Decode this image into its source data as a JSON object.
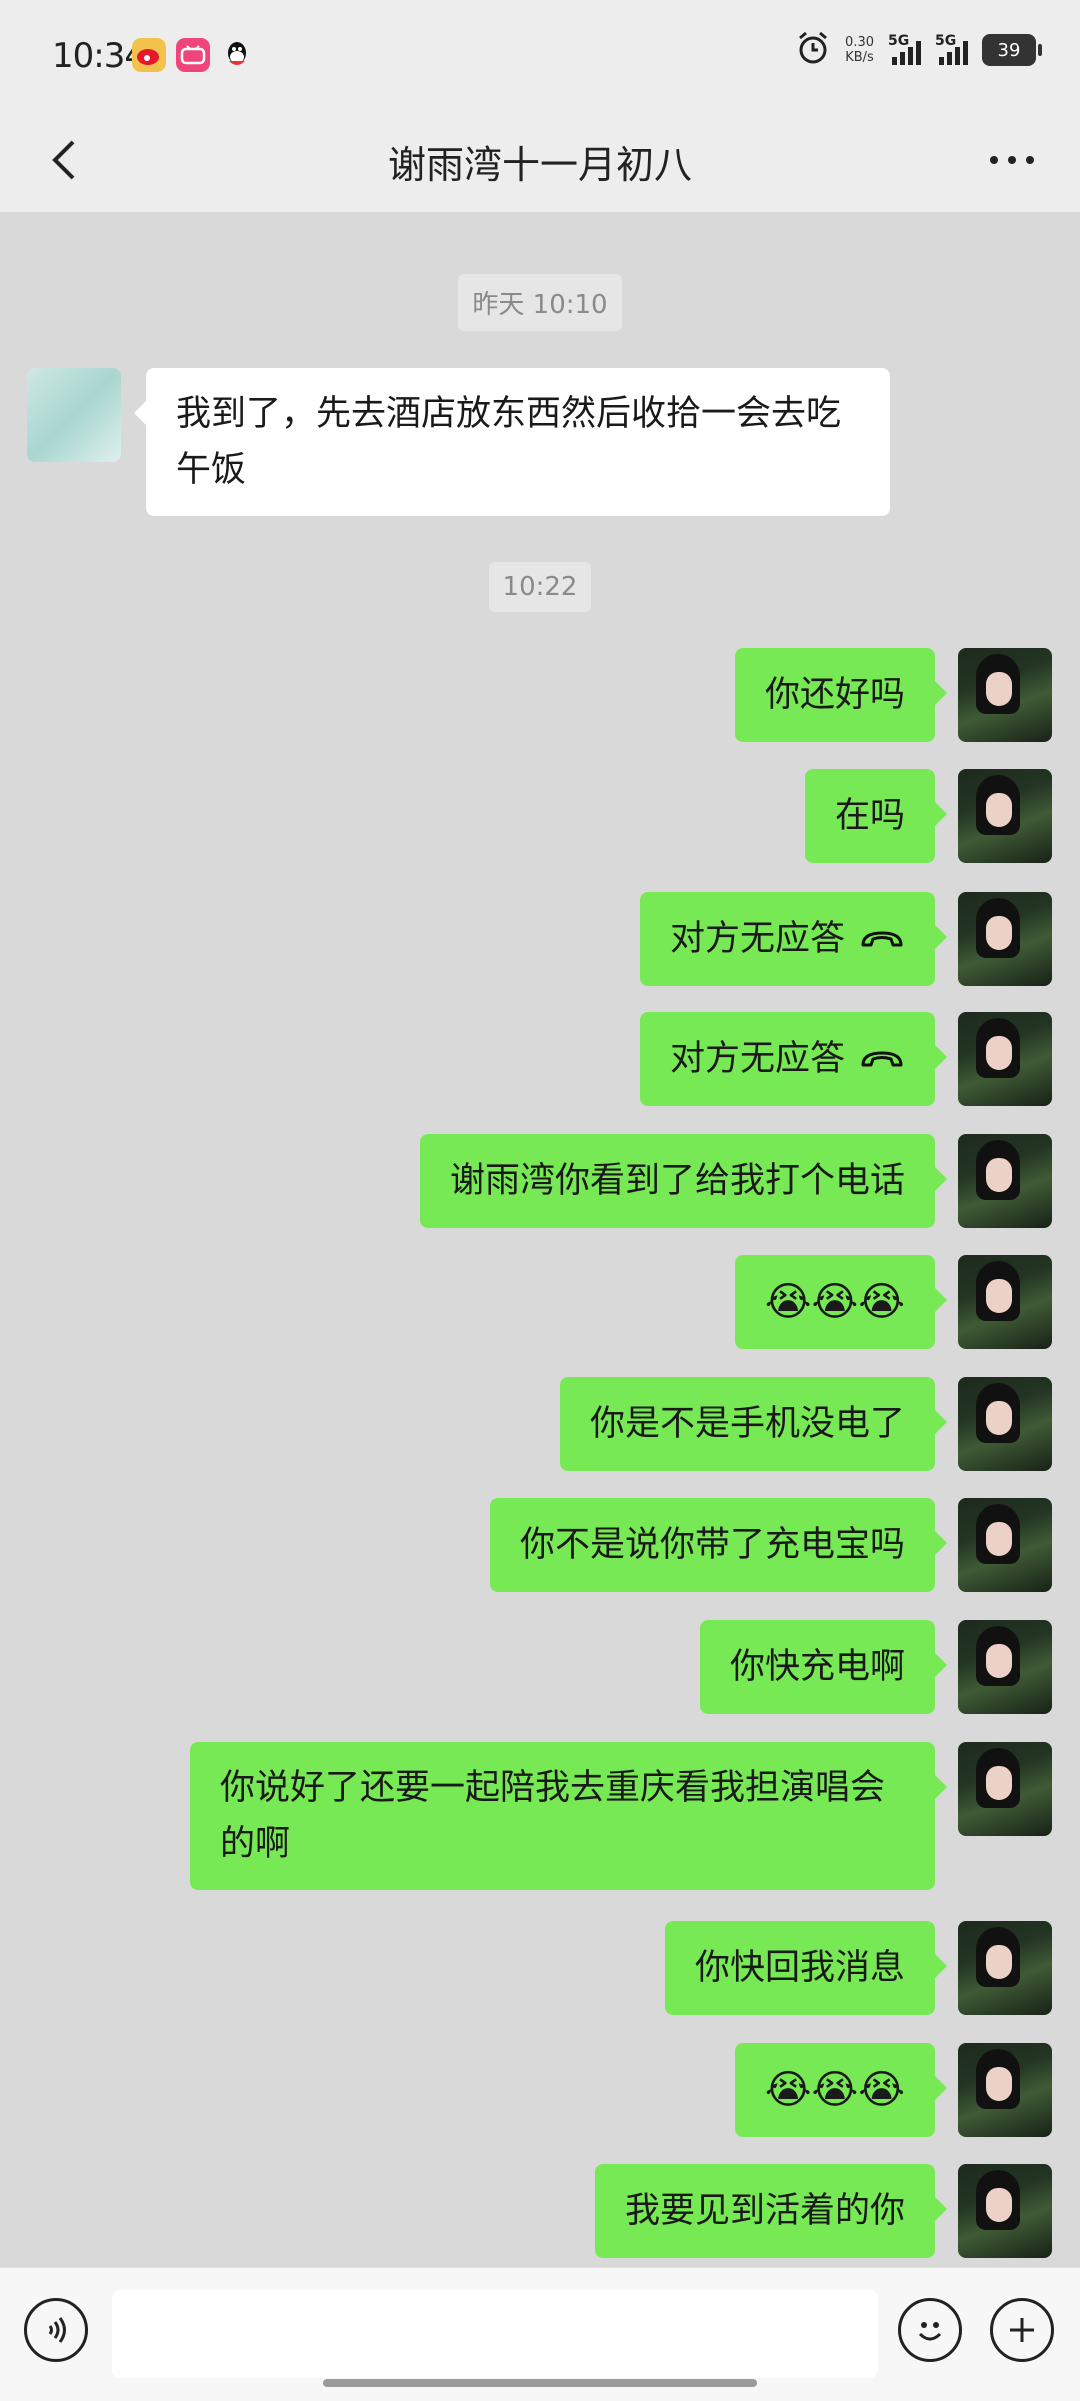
{
  "status": {
    "time": "10:34",
    "net_speed": "0.30",
    "net_unit": "KB/s",
    "sim1": "5G",
    "sim2": "5G",
    "battery": "39"
  },
  "header": {
    "title": "谢雨湾十一月初八"
  },
  "timestamps": [
    "昨天 10:10",
    "10:22"
  ],
  "messages": [
    {
      "sender": "other",
      "text": "我到了，先去酒店放东西然后收拾一会去吃午饭"
    },
    {
      "sender": "me",
      "text": "你还好吗"
    },
    {
      "sender": "me",
      "text": "在吗"
    },
    {
      "sender": "me",
      "text": "对方无应答",
      "icon": "hangup-icon"
    },
    {
      "sender": "me",
      "text": "对方无应答",
      "icon": "hangup-icon"
    },
    {
      "sender": "me",
      "text": "谢雨湾你看到了给我打个电话"
    },
    {
      "sender": "me",
      "text": "😭😭😭"
    },
    {
      "sender": "me",
      "text": "你是不是手机没电了"
    },
    {
      "sender": "me",
      "text": "你不是说你带了充电宝吗"
    },
    {
      "sender": "me",
      "text": "你快充电啊"
    },
    {
      "sender": "me",
      "text": "你说好了还要一起陪我去重庆看我担演唱会的啊"
    },
    {
      "sender": "me",
      "text": "你快回我消息"
    },
    {
      "sender": "me",
      "text": "😭😭😭"
    },
    {
      "sender": "me",
      "text": "我要见到活着的你"
    }
  ],
  "input": {
    "placeholder": ""
  },
  "colors": {
    "my_bubble": "#77e955",
    "other_bubble": "#ffffff",
    "chat_bg": "#d9d9d9"
  }
}
